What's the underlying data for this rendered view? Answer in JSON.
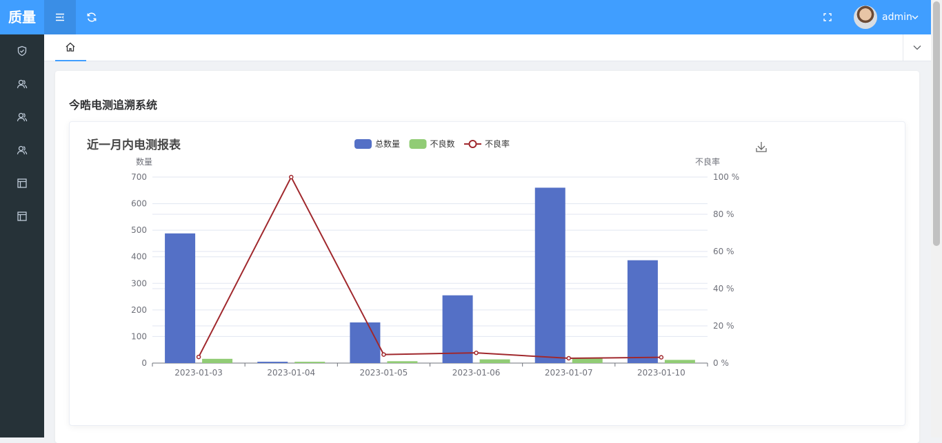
{
  "header": {
    "logo": "质量",
    "username": "admin"
  },
  "page": {
    "system_title": "今晧电测追溯系统"
  },
  "colors": {
    "header_bg": "#409eff",
    "sidebar_bg": "#263238",
    "series_total": "#5470c6",
    "series_defect": "#91cc75",
    "series_rate": "#a0282d"
  },
  "chart_data": {
    "type": "bar",
    "title": "近一月内电测报表",
    "categories": [
      "2023-01-03",
      "2023-01-04",
      "2023-01-05",
      "2023-01-06",
      "2023-01-07",
      "2023-01-10"
    ],
    "series": [
      {
        "name": "总数量",
        "type": "bar",
        "axis": "left",
        "values": [
          488,
          5,
          153,
          255,
          660,
          387
        ]
      },
      {
        "name": "不良数",
        "type": "bar",
        "axis": "left",
        "values": [
          16,
          5,
          7,
          14,
          17,
          12
        ]
      },
      {
        "name": "不良率",
        "type": "line",
        "axis": "right",
        "values": [
          3.3,
          100,
          4.6,
          5.5,
          2.6,
          3.1
        ]
      }
    ],
    "ylabel": "数量",
    "ylim": [
      0,
      700
    ],
    "yticks": [
      "0",
      "100",
      "200",
      "300",
      "400",
      "500",
      "600",
      "700"
    ],
    "y2label": "不良率",
    "y2lim": [
      0,
      100
    ],
    "y2ticks": [
      "0 %",
      "20 %",
      "40 %",
      "60 %",
      "80 %",
      "100 %"
    ],
    "legend_position": "top-center",
    "grid": true
  }
}
